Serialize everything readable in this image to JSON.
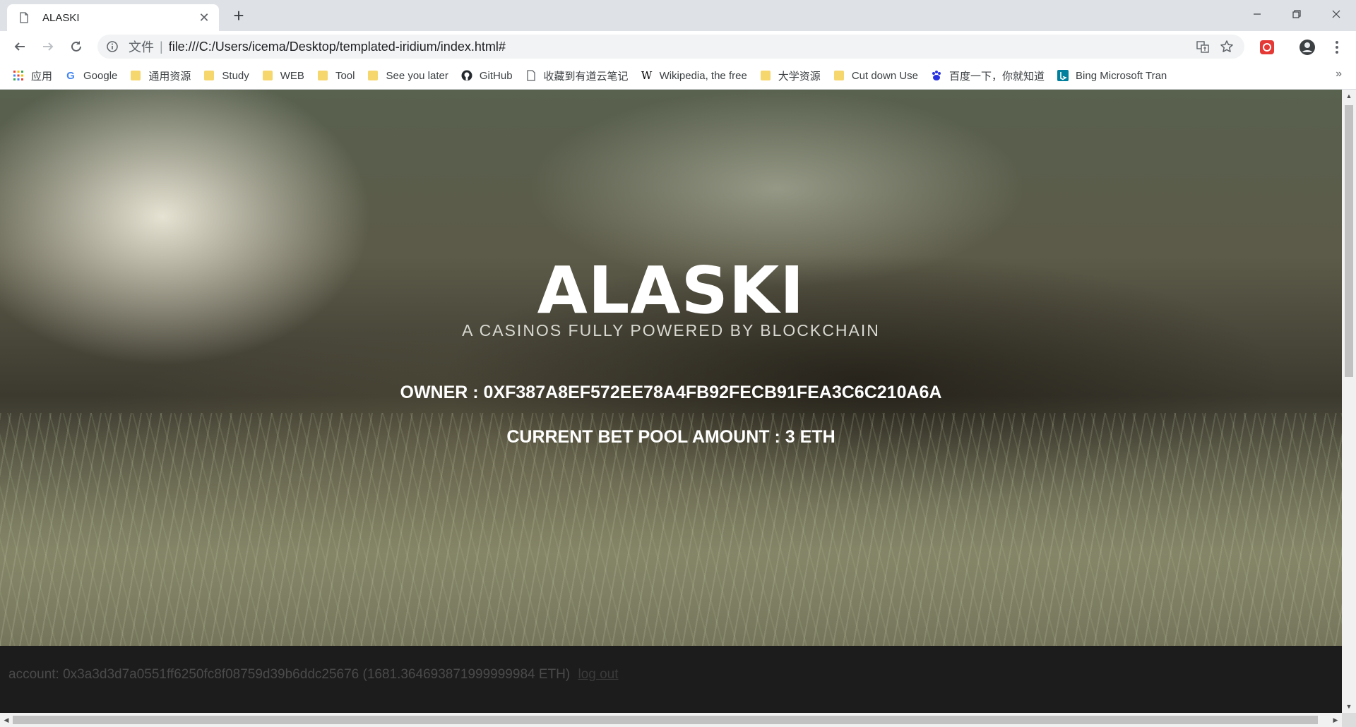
{
  "browser": {
    "tab": {
      "title": "ALASKI"
    },
    "omnibox": {
      "scheme_label": "文件",
      "url": "file:///C:/Users/icema/Desktop/templated-iridium/index.html#"
    },
    "bookmarks": [
      {
        "label": "应用",
        "icon": "apps-grid-icon"
      },
      {
        "label": "Google",
        "icon": "google-icon"
      },
      {
        "label": "通用资源",
        "icon": "folder-icon"
      },
      {
        "label": "Study",
        "icon": "folder-icon"
      },
      {
        "label": "WEB",
        "icon": "folder-icon"
      },
      {
        "label": "Tool",
        "icon": "folder-icon"
      },
      {
        "label": "See you later",
        "icon": "folder-icon"
      },
      {
        "label": "GitHub",
        "icon": "github-icon"
      },
      {
        "label": "收藏到有道云笔记",
        "icon": "page-icon"
      },
      {
        "label": "Wikipedia, the free",
        "icon": "wikipedia-icon"
      },
      {
        "label": "大学资源",
        "icon": "folder-icon"
      },
      {
        "label": "Cut down Use",
        "icon": "folder-icon"
      },
      {
        "label": "百度一下，你就知道",
        "icon": "baidu-icon"
      },
      {
        "label": "Bing Microsoft Tran",
        "icon": "bing-icon"
      }
    ],
    "overflow_label": "»"
  },
  "hero": {
    "title": "ALASKI",
    "tagline": "A CASINOS FULLY POWERED BY BLOCKCHAIN",
    "owner_text": "OWNER : 0XF387A8EF572EE78A4FB92FECB91FEA3C6C210A6A",
    "pool_text": "CURRENT BET POOL AMOUNT : 3 ETH"
  },
  "footer": {
    "account_text": "account: 0x3a3d3d7a0551ff6250fc8f08759d39b6ddc25676 (1681.364693871999999984 ETH)",
    "logout_label": "log out"
  },
  "colors": {
    "hero_text": "#ffffff",
    "footer_bg": "#1c1c1c",
    "footer_text": "#4a4a4a"
  }
}
